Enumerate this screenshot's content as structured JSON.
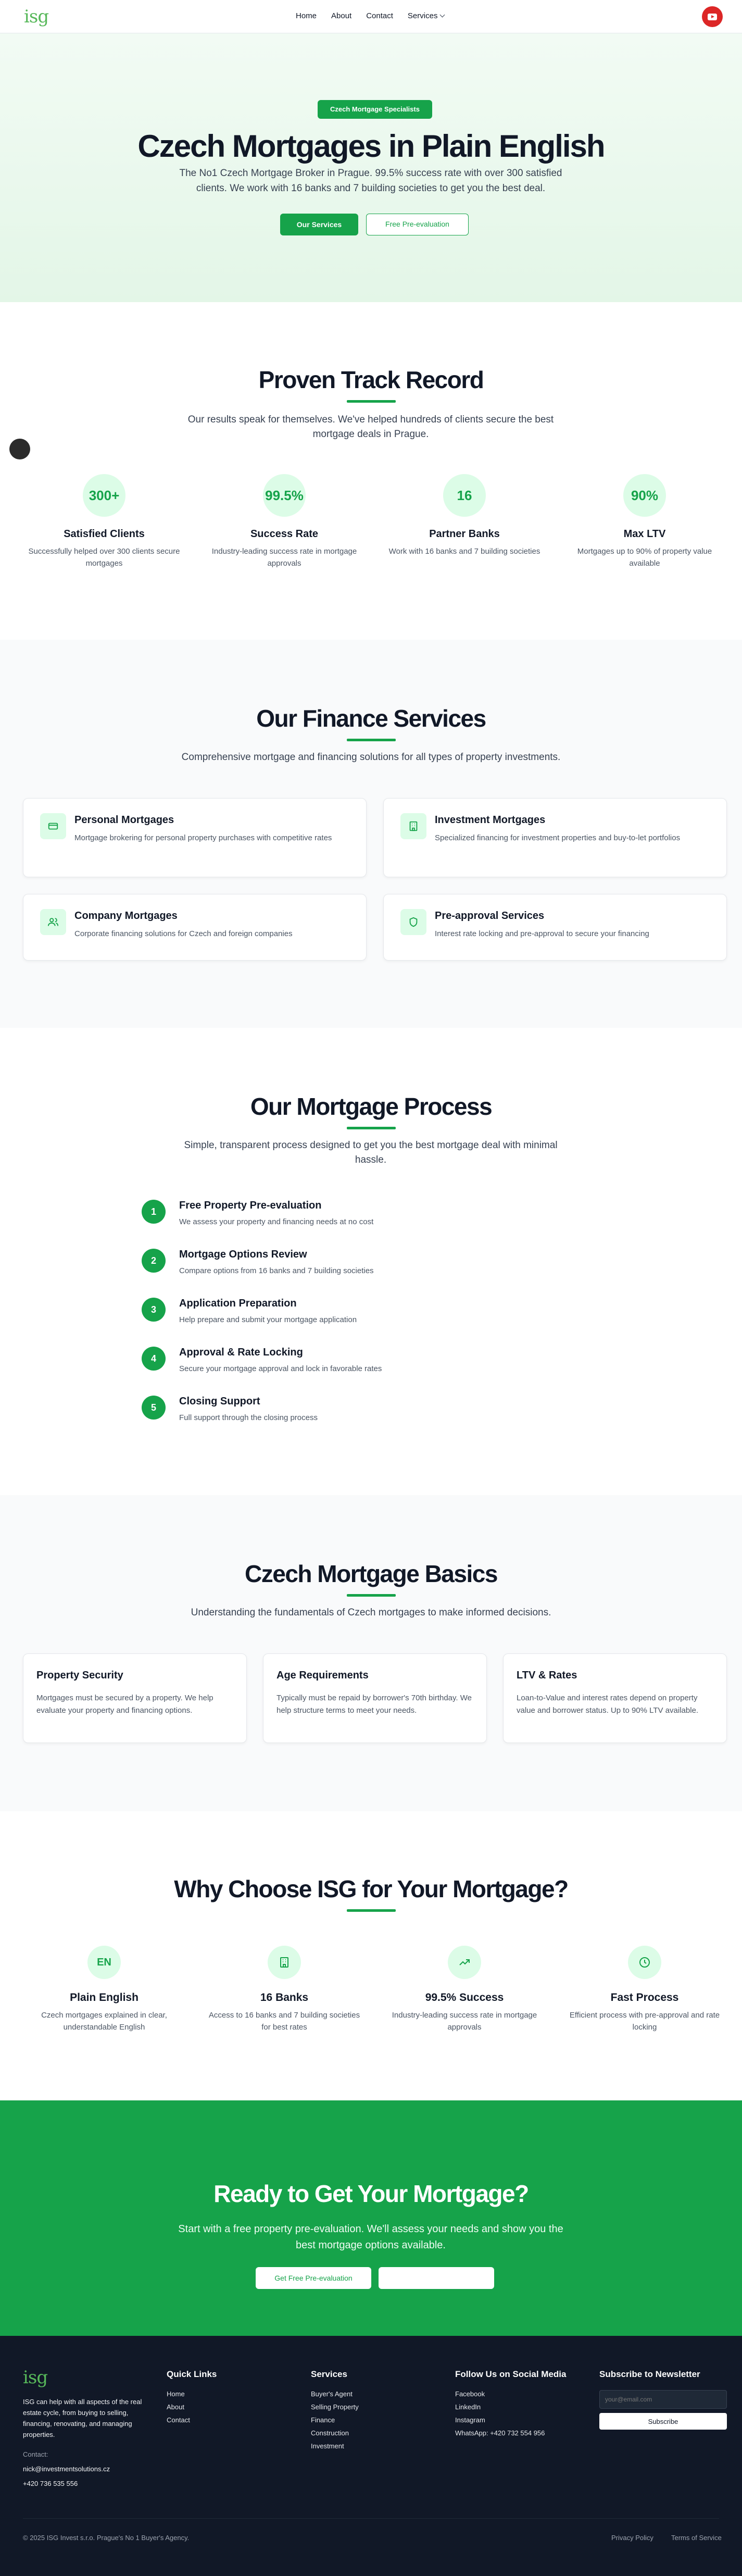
{
  "header": {
    "logo": "isg",
    "nav": [
      "Home",
      "About",
      "Contact",
      "Services"
    ]
  },
  "hero": {
    "badge": "Czech Mortgage Specialists",
    "title": "Czech Mortgages in Plain English",
    "subtitle": "The No1 Czech Mortgage Broker in Prague. 99.5% success rate with over 300 satisfied clients. We work with 16 banks and 7 building societies to get you the best deal.",
    "primary_button": "Our Services",
    "secondary_button": "Free Pre-evaluation"
  },
  "track_record": {
    "title": "Proven Track Record",
    "subtitle": "Our results speak for themselves. We've helped hundreds of clients secure the best mortgage deals in Prague.",
    "stats": [
      {
        "value": "300+",
        "title": "Satisfied Clients",
        "desc": "Successfully helped over 300 clients secure mortgages"
      },
      {
        "value": "99.5%",
        "title": "Success Rate",
        "desc": "Industry-leading success rate in mortgage approvals"
      },
      {
        "value": "16",
        "title": "Partner Banks",
        "desc": "Work with 16 banks and 7 building societies"
      },
      {
        "value": "90%",
        "title": "Max LTV",
        "desc": "Mortgages up to 90% of property value available"
      }
    ]
  },
  "services": {
    "title": "Our Finance Services",
    "subtitle": "Comprehensive mortgage and financing solutions for all types of property investments.",
    "items": [
      {
        "icon": "card-icon",
        "title": "Personal Mortgages",
        "desc": "Mortgage brokering for personal property purchases with competitive rates"
      },
      {
        "icon": "building-icon",
        "title": "Investment Mortgages",
        "desc": "Specialized financing for investment properties and buy-to-let portfolios"
      },
      {
        "icon": "users-icon",
        "title": "Company Mortgages",
        "desc": "Corporate financing solutions for Czech and foreign companies"
      },
      {
        "icon": "shield-icon",
        "title": "Pre-approval Services",
        "desc": "Interest rate locking and pre-approval to secure your financing"
      }
    ]
  },
  "process": {
    "title": "Our Mortgage Process",
    "subtitle": "Simple, transparent process designed to get you the best mortgage deal with minimal hassle.",
    "steps": [
      {
        "num": "1",
        "title": "Free Property Pre-evaluation",
        "desc": "We assess your property and financing needs at no cost"
      },
      {
        "num": "2",
        "title": "Mortgage Options Review",
        "desc": "Compare options from 16 banks and 7 building societies"
      },
      {
        "num": "3",
        "title": "Application Preparation",
        "desc": "Help prepare and submit your mortgage application"
      },
      {
        "num": "4",
        "title": "Approval & Rate Locking",
        "desc": "Secure your mortgage approval and lock in favorable rates"
      },
      {
        "num": "5",
        "title": "Closing Support",
        "desc": "Full support through the closing process"
      }
    ]
  },
  "basics": {
    "title": "Czech Mortgage Basics",
    "subtitle": "Understanding the fundamentals of Czech mortgages to make informed decisions.",
    "cards": [
      {
        "title": "Property Security",
        "desc": "Mortgages must be secured by a property. We help evaluate your property and financing options."
      },
      {
        "title": "Age Requirements",
        "desc": "Typically must be repaid by borrower's 70th birthday. We help structure terms to meet your needs."
      },
      {
        "title": "LTV & Rates",
        "desc": "Loan-to-Value and interest rates depend on property value and borrower status. Up to 90% LTV available."
      }
    ]
  },
  "why": {
    "title": "Why Choose ISG for Your Mortgage?",
    "items": [
      {
        "icon_text": "EN",
        "title": "Plain English",
        "desc": "Czech mortgages explained in clear, understandable English"
      },
      {
        "icon": "bank-icon",
        "title": "16 Banks",
        "desc": "Access to 16 banks and 7 building societies for best rates"
      },
      {
        "icon": "trend-up-icon",
        "title": "99.5% Success",
        "desc": "Industry-leading success rate in mortgage approvals"
      },
      {
        "icon": "clock-icon",
        "title": "Fast Process",
        "desc": "Efficient process with pre-approval and rate locking"
      }
    ]
  },
  "cta": {
    "title": "Ready to Get Your Mortgage?",
    "subtitle": "Start with a free property pre-evaluation. We'll assess your needs and show you the best mortgage options available.",
    "button": "Get Free Pre-evaluation",
    "button2": ""
  },
  "footer": {
    "logo": "isg",
    "about": "ISG can help with all aspects of the real estate cycle, from buying to selling, financing, renovating, and managing properties.",
    "contact_label": "Contact:",
    "email": "nick@investmentsolutions.cz",
    "phone": "+420 736 535 556",
    "quick_links": {
      "title": "Quick Links",
      "links": [
        "Home",
        "About",
        "Contact"
      ]
    },
    "services": {
      "title": "Services",
      "links": [
        "Buyer's Agent",
        "Selling Property",
        "Finance",
        "Construction",
        "Investment"
      ]
    },
    "social": {
      "title": "Follow Us on Social Media",
      "links": [
        "Facebook",
        "LinkedIn",
        "Instagram",
        "WhatsApp: +420 732 554 956"
      ]
    },
    "newsletter": {
      "title": "Subscribe to Newsletter",
      "placeholder": "your@email.com",
      "button": "Subscribe"
    },
    "copyright": "© 2025 ISG Invest s.r.o. Prague's No 1 Buyer's Agency.",
    "privacy": "Privacy Policy",
    "terms": "Terms of Service"
  },
  "colors": {
    "brand_green": "#16a34a",
    "light_green": "#dcfce7",
    "footer_bg": "#111827",
    "youtube_red": "#dc2626"
  }
}
